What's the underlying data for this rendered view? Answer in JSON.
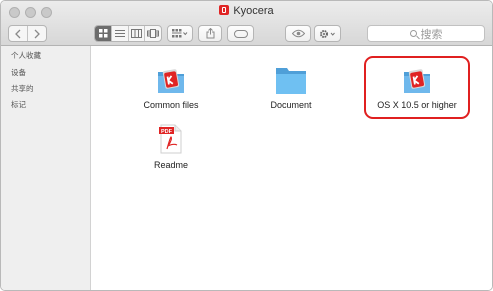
{
  "window": {
    "title": "Kyocera",
    "title_icon": "kyocera-app-icon"
  },
  "toolbar": {
    "back_icon": "chevron-left-icon",
    "forward_icon": "chevron-right-icon",
    "view_modes": [
      "icon-view-icon",
      "list-view-icon",
      "column-view-icon",
      "cover-flow-icon"
    ],
    "arrange_icon": "grid-arrange-icon",
    "share_icon": "share-icon",
    "tag_icon": "tag-icon",
    "quicklook_icon": "eye-icon",
    "action_icon": "gear-icon",
    "search": {
      "placeholder": "搜索"
    }
  },
  "sidebar": {
    "items": [
      {
        "label": "个人收藏"
      },
      {
        "label": "设备"
      },
      {
        "label": "共享的"
      },
      {
        "label": "标记"
      }
    ]
  },
  "files": [
    {
      "name": "Common files",
      "icon": "folder-kyocera-icon"
    },
    {
      "name": "Document",
      "icon": "folder-icon"
    },
    {
      "name": "OS X 10.5 or higher",
      "icon": "folder-kyocera-icon",
      "highlighted": true
    },
    {
      "name": "Readme",
      "icon": "pdf-icon"
    }
  ],
  "colors": {
    "highlight": "#e02020",
    "folder": "#5aaee8",
    "kyocera_red": "#e02424"
  }
}
